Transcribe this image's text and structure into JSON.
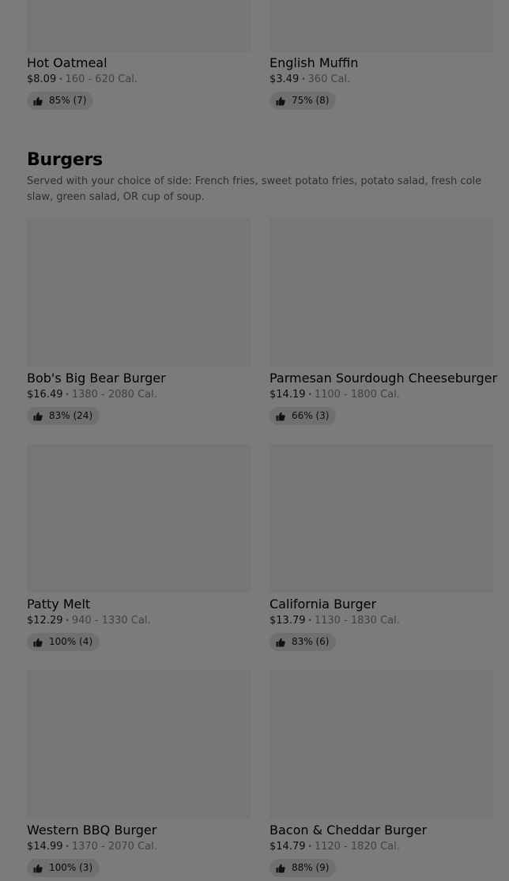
{
  "breakfast_items": [
    {
      "name": "Hot Oatmeal",
      "price": "$8.09",
      "calories": "160 - 620 Cal.",
      "rating": "85% (7)"
    },
    {
      "name": "English Muffin",
      "price": "$3.49",
      "calories": "360 Cal.",
      "rating": "75% (8)"
    }
  ],
  "section": {
    "title": "Burgers",
    "description": "Served with your choice of side: French fries, sweet potato fries, potato salad, fresh cole slaw, green salad, OR cup of soup."
  },
  "items": [
    {
      "name": "Bob's Big Bear Burger",
      "price": "$16.49",
      "calories": "1380 - 2080 Cal.",
      "rating": "83% (24)"
    },
    {
      "name": "Parmesan Sourdough Cheeseburger",
      "price": "$14.19",
      "calories": "1100 - 1800 Cal.",
      "rating": "66% (3)"
    },
    {
      "name": "Patty Melt",
      "price": "$12.29",
      "calories": "940 - 1330 Cal.",
      "rating": "100% (4)"
    },
    {
      "name": "California Burger",
      "price": "$13.79",
      "calories": "1130 - 1830 Cal.",
      "rating": "83% (6)"
    },
    {
      "name": "Western BBQ Burger",
      "price": "$14.99",
      "calories": "1370 - 2070 Cal.",
      "rating": "100% (3)"
    },
    {
      "name": "Bacon & Cheddar Burger",
      "price": "$14.79",
      "calories": "1120 - 1820 Cal.",
      "rating": "88% (9)"
    }
  ],
  "separator": "•",
  "icons": {
    "rating": "thumbs-up-icon"
  },
  "colors": {
    "overlay": "#7b7b7b",
    "image_placeholder": "#767676",
    "badge": "#6f6f6f"
  }
}
